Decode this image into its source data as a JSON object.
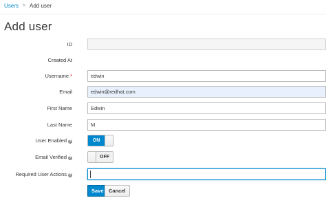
{
  "breadcrumb": {
    "parent": "Users",
    "separator": ">",
    "current": "Add user"
  },
  "page": {
    "title": "Add user"
  },
  "form": {
    "id": {
      "label": "ID",
      "value": ""
    },
    "created_at": {
      "label": "Created At",
      "value": ""
    },
    "username": {
      "label": "Username",
      "required_mark": "*",
      "value": "edwin"
    },
    "email": {
      "label": "Email",
      "value": "edwin@redhat.com"
    },
    "first_name": {
      "label": "First Name",
      "value": "Edwin"
    },
    "last_name": {
      "label": "Last Name",
      "value": "M"
    },
    "user_enabled": {
      "label": "User Enabled",
      "help_icon": "?",
      "state_label": "ON",
      "state": true
    },
    "email_verified": {
      "label": "Email Verified",
      "help_icon": "?",
      "state_label": "OFF",
      "state": false
    },
    "required_actions": {
      "label": "Required User Actions",
      "help_icon": "?",
      "value": ""
    }
  },
  "actions": {
    "save_label": "Save",
    "cancel_label": "Cancel"
  },
  "colors": {
    "accent": "#0088ce",
    "required": "#cc0000",
    "autofill_bg": "#e8f0fe"
  },
  "icons": {
    "breadcrumb_separator": "chevron-right-icon",
    "help": "help-circle-icon"
  }
}
